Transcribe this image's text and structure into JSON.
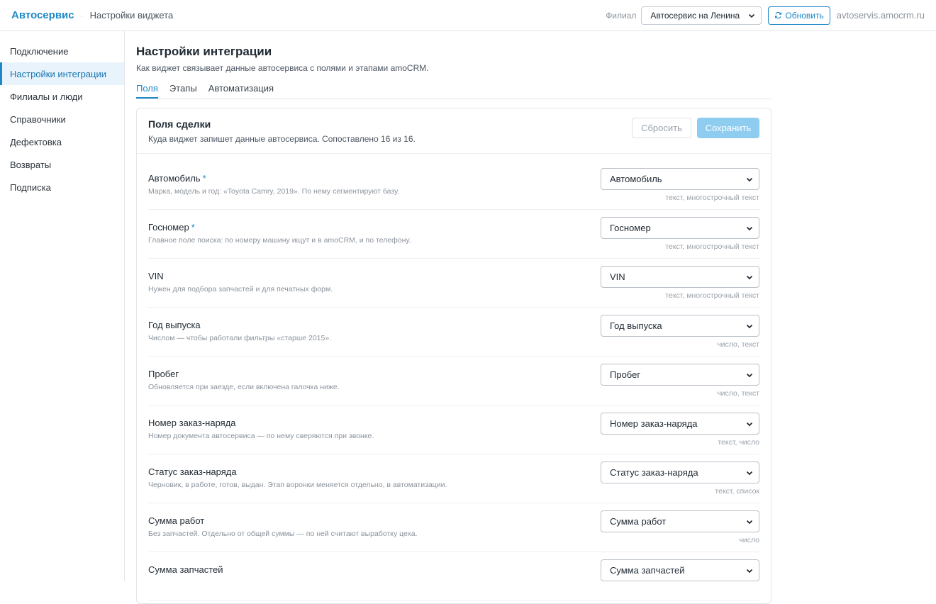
{
  "header": {
    "brand": "Автосервис",
    "crumb_separator": "·",
    "crumb": "Настройки виджета",
    "branch_label": "Филиал",
    "branch_value": "Автосервис на Ленина",
    "refresh_label": "Обновить",
    "domain": "avtoservis.amocrm.ru"
  },
  "sidebar": {
    "items": [
      {
        "label": "Подключение"
      },
      {
        "label": "Настройки интеграции"
      },
      {
        "label": "Филиалы и люди"
      },
      {
        "label": "Справочники"
      },
      {
        "label": "Дефектовка"
      },
      {
        "label": "Возвраты"
      },
      {
        "label": "Подписка"
      }
    ]
  },
  "main": {
    "title": "Настройки интеграции",
    "subtitle": "Как виджет связывает данные автосервиса с полями и этапами amoCRM.",
    "tabs": [
      {
        "label": "Поля"
      },
      {
        "label": "Этапы"
      },
      {
        "label": "Автоматизация"
      }
    ]
  },
  "card": {
    "title": "Поля сделки",
    "subtitle": "Куда виджет запишет данные автосервиса. Сопоставлено 16 из 16.",
    "reset_label": "Сбросить",
    "save_label": "Сохранить",
    "required_mark": "*",
    "fields": [
      {
        "label": "Автомобиль",
        "hint": "Марка, модель и год: «Toyota Camry, 2019». По нему сегментируют базу.",
        "value": "Автомобиль",
        "types": "текст, многострочный текст"
      },
      {
        "label": "Госномер",
        "hint": "Главное поле поиска: по номеру машину ищут и в amoCRM, и по телефону.",
        "value": "Госномер",
        "types": "текст, многострочный текст"
      },
      {
        "label": "VIN",
        "hint": "Нужен для подбора запчастей и для печатных форм.",
        "value": "VIN",
        "types": "текст, многострочный текст"
      },
      {
        "label": "Год выпуска",
        "hint": "Числом — чтобы работали фильтры «старше 2015».",
        "value": "Год выпуска",
        "types": "число, текст"
      },
      {
        "label": "Пробег",
        "hint": "Обновляется при заезде, если включена галочка ниже.",
        "value": "Пробег",
        "types": "число, текст"
      },
      {
        "label": "Номер заказ-наряда",
        "hint": "Номер документа автосервиса — по нему сверяются при звонке.",
        "value": "Номер заказ-наряда",
        "types": "текст, число"
      },
      {
        "label": "Статус заказ-наряда",
        "hint": "Черновик, в работе, готов, выдан. Этап воронки меняется отдельно, в автоматизации.",
        "value": "Статус заказ-наряда",
        "types": "текст, список"
      },
      {
        "label": "Сумма работ",
        "hint": "Без запчастей. Отдельно от общей суммы — по ней считают выработку цеха.",
        "value": "Сумма работ",
        "types": "число"
      },
      {
        "label": "Сумма запчастей",
        "hint": "",
        "value": "Сумма запчастей",
        "types": ""
      }
    ]
  },
  "colors": {
    "accent": "#1e88c7",
    "save_disabled": "#8fcdf0",
    "active_bg": "#e8f3fb"
  }
}
